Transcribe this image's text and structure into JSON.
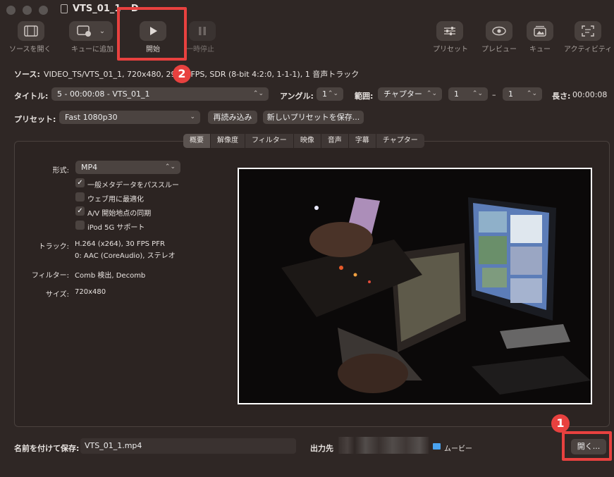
{
  "window": {
    "title": "VTS_01_1 - D"
  },
  "toolbar": {
    "items": [
      {
        "label": "ソースを開く",
        "icon": "film-icon"
      },
      {
        "label": "キューに追加",
        "icon": "add-to-queue-icon"
      },
      {
        "label": "開始",
        "icon": "play-icon"
      },
      {
        "label": "一時停止",
        "icon": "pause-icon"
      },
      {
        "label": "プリセット",
        "icon": "sliders-icon"
      },
      {
        "label": "プレビュー",
        "icon": "eye-icon"
      },
      {
        "label": "キュー",
        "icon": "queue-icon"
      },
      {
        "label": "アクティビティ",
        "icon": "activity-icon"
      }
    ]
  },
  "source": {
    "label": "ソース:",
    "value": "VIDEO_TS/VTS_01_1, 720x480, 29.97 FPS, SDR (8-bit 4:2:0, 1-1-1), 1 音声トラック"
  },
  "title_row": {
    "label": "タイトル:",
    "title_value": "5 - 00:00:08 - VTS_01_1",
    "angle_label": "アングル:",
    "angle_value": "1",
    "range_label": "範囲:",
    "range_type": "チャプター",
    "range_start": "1",
    "range_dash": "–",
    "range_end": "1",
    "duration_label": "長さ:",
    "duration_value": "00:00:08"
  },
  "preset_row": {
    "label": "プリセット:",
    "value": "Fast 1080p30",
    "reload_button": "再読み込み",
    "save_button": "新しいプリセットを保存..."
  },
  "tabs": [
    "概要",
    "解像度",
    "フィルター",
    "映像",
    "音声",
    "字幕",
    "チャプター"
  ],
  "summary": {
    "format_label": "形式:",
    "format_value": "MP4",
    "checkboxes": [
      {
        "label": "一般メタデータをパススルー",
        "checked": true
      },
      {
        "label": "ウェブ用に最適化",
        "checked": false
      },
      {
        "label": "A/V 開始地点の同期",
        "checked": true
      },
      {
        "label": "iPod 5G サポート",
        "checked": false
      }
    ],
    "tracks_label": "トラック:",
    "tracks_line1": "H.264 (x264), 30 FPS PFR",
    "tracks_line2": "0: AAC (CoreAudio), ステレオ",
    "filters_label": "フィルター:",
    "filters_value": "Comb 検出, Decomb",
    "size_label": "サイズ:",
    "size_value": "720x480"
  },
  "save": {
    "label": "名前を付けて保存:",
    "filename": "VTS_01_1.mp4",
    "dest_label": "出力先",
    "folder": "ムービー",
    "open_button": "開く..."
  },
  "annotations": {
    "badge1": "1",
    "badge2": "2",
    "color": "#e8413f"
  }
}
